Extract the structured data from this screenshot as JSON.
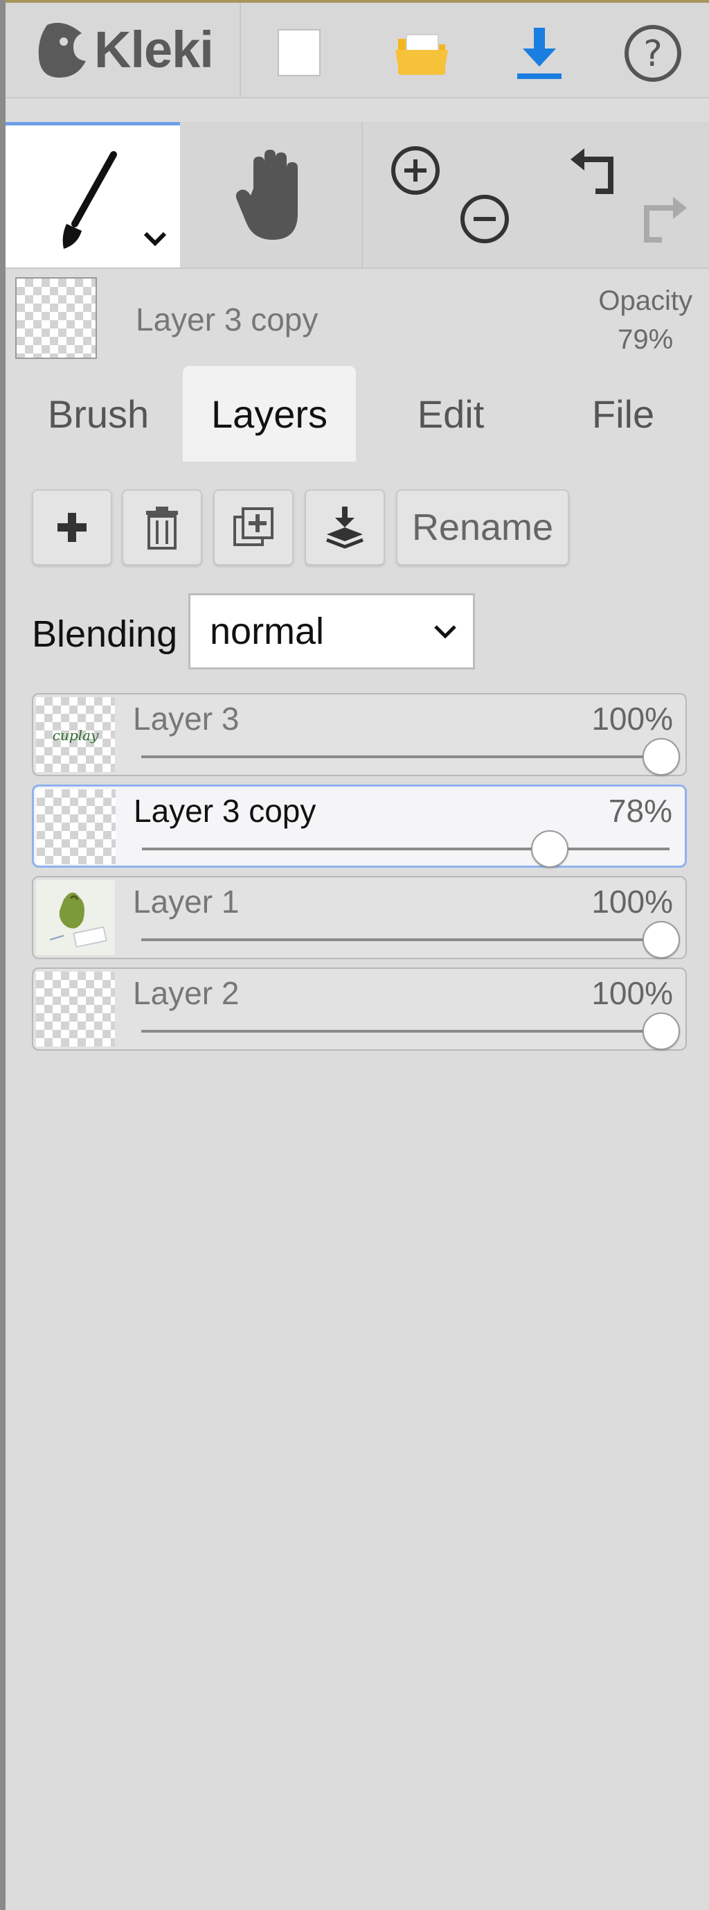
{
  "app": {
    "name": "Kleki"
  },
  "toolbar": {
    "new_icon": "new-file-icon",
    "open_icon": "folder-open-icon",
    "save_icon": "download-icon",
    "help_icon": "help-icon"
  },
  "tools": {
    "brush_icon": "brush-icon",
    "hand_icon": "hand-icon",
    "zoom_in_icon": "zoom-in-icon",
    "zoom_out_icon": "zoom-out-icon",
    "undo_icon": "undo-icon",
    "redo_icon": "redo-icon"
  },
  "preview": {
    "layer_name": "Layer 3 copy",
    "opacity_label": "Opacity",
    "opacity_value": "79%"
  },
  "tabs": [
    {
      "label": "Brush",
      "active": false
    },
    {
      "label": "Layers",
      "active": true
    },
    {
      "label": "Edit",
      "active": false
    },
    {
      "label": "File",
      "active": false
    }
  ],
  "layer_actions": {
    "rename_label": "Rename",
    "blending_label": "Blending",
    "blending_value": "normal"
  },
  "layers": [
    {
      "name": "Layer 3",
      "opacity_text": "100%",
      "opacity": 1.0,
      "active": false
    },
    {
      "name": "Layer 3 copy",
      "opacity_text": "78%",
      "opacity": 0.78,
      "active": true
    },
    {
      "name": "Layer 1",
      "opacity_text": "100%",
      "opacity": 1.0,
      "active": false
    },
    {
      "name": "Layer 2",
      "opacity_text": "100%",
      "opacity": 1.0,
      "active": false
    }
  ],
  "colors": {
    "accent": "#6e9fe6",
    "download_blue": "#1a7de0",
    "folder_yellow": "#f3b61f"
  }
}
